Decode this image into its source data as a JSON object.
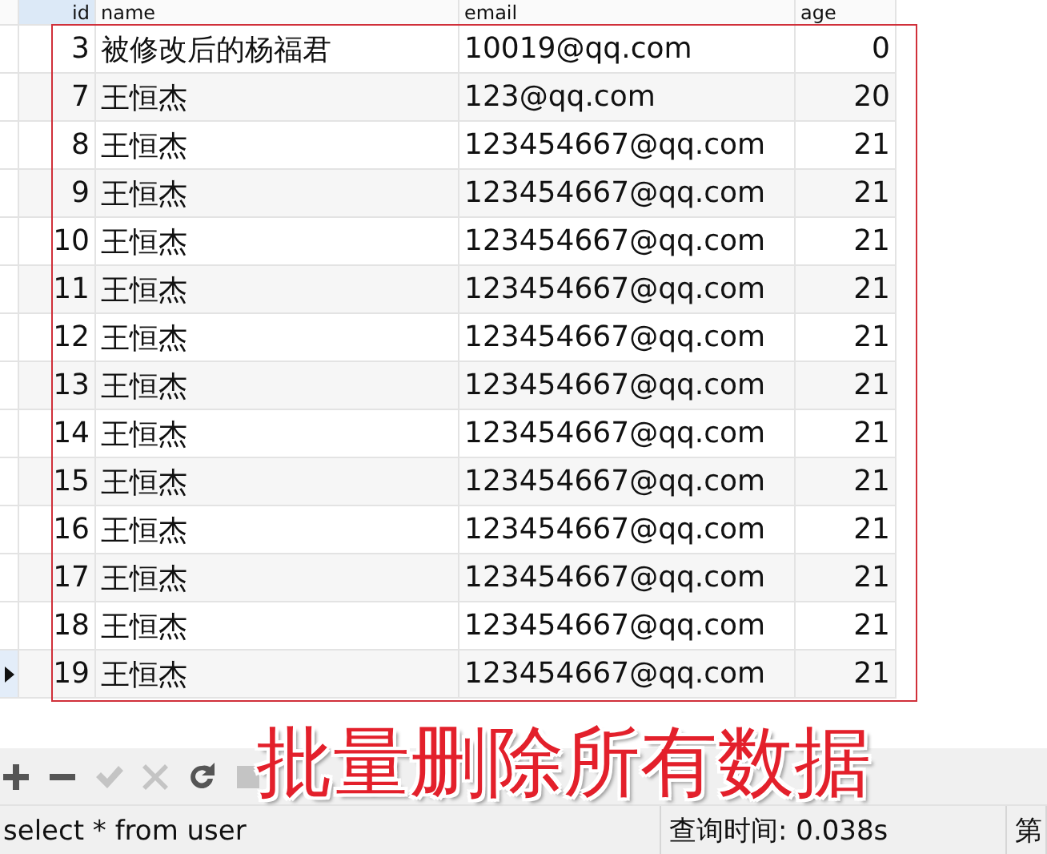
{
  "table": {
    "columns": [
      {
        "label": "id",
        "selected": true
      },
      {
        "label": "name",
        "selected": false
      },
      {
        "label": "email",
        "selected": false
      },
      {
        "label": "age",
        "selected": false
      }
    ],
    "rows": [
      {
        "id": "3",
        "name": "被修改后的杨福君",
        "email": "10019@qq.com",
        "age": "0",
        "current": false
      },
      {
        "id": "7",
        "name": "王恒杰",
        "email": "123@qq.com",
        "age": "20",
        "current": false
      },
      {
        "id": "8",
        "name": "王恒杰",
        "email": "123454667@qq.com",
        "age": "21",
        "current": false
      },
      {
        "id": "9",
        "name": "王恒杰",
        "email": "123454667@qq.com",
        "age": "21",
        "current": false
      },
      {
        "id": "10",
        "name": "王恒杰",
        "email": "123454667@qq.com",
        "age": "21",
        "current": false
      },
      {
        "id": "11",
        "name": "王恒杰",
        "email": "123454667@qq.com",
        "age": "21",
        "current": false
      },
      {
        "id": "12",
        "name": "王恒杰",
        "email": "123454667@qq.com",
        "age": "21",
        "current": false
      },
      {
        "id": "13",
        "name": "王恒杰",
        "email": "123454667@qq.com",
        "age": "21",
        "current": false
      },
      {
        "id": "14",
        "name": "王恒杰",
        "email": "123454667@qq.com",
        "age": "21",
        "current": false
      },
      {
        "id": "15",
        "name": "王恒杰",
        "email": "123454667@qq.com",
        "age": "21",
        "current": false
      },
      {
        "id": "16",
        "name": "王恒杰",
        "email": "123454667@qq.com",
        "age": "21",
        "current": false
      },
      {
        "id": "17",
        "name": "王恒杰",
        "email": "123454667@qq.com",
        "age": "21",
        "current": false
      },
      {
        "id": "18",
        "name": "王恒杰",
        "email": "123454667@qq.com",
        "age": "21",
        "current": false
      },
      {
        "id": "19",
        "name": "王恒杰",
        "email": "123454667@qq.com",
        "age": "21",
        "current": true
      }
    ]
  },
  "toolbar": {
    "buttons": [
      {
        "kind": "add",
        "disabled": false
      },
      {
        "kind": "remove",
        "disabled": false
      },
      {
        "kind": "apply",
        "disabled": true
      },
      {
        "kind": "discard",
        "disabled": true
      },
      {
        "kind": "refresh",
        "disabled": false
      },
      {
        "kind": "stop",
        "disabled": true
      }
    ]
  },
  "annotation": {
    "text": "批量删除所有数据"
  },
  "status_bar": {
    "sql": "select * from user",
    "query_time": "查询时间: 0.038s",
    "record": "第"
  }
}
